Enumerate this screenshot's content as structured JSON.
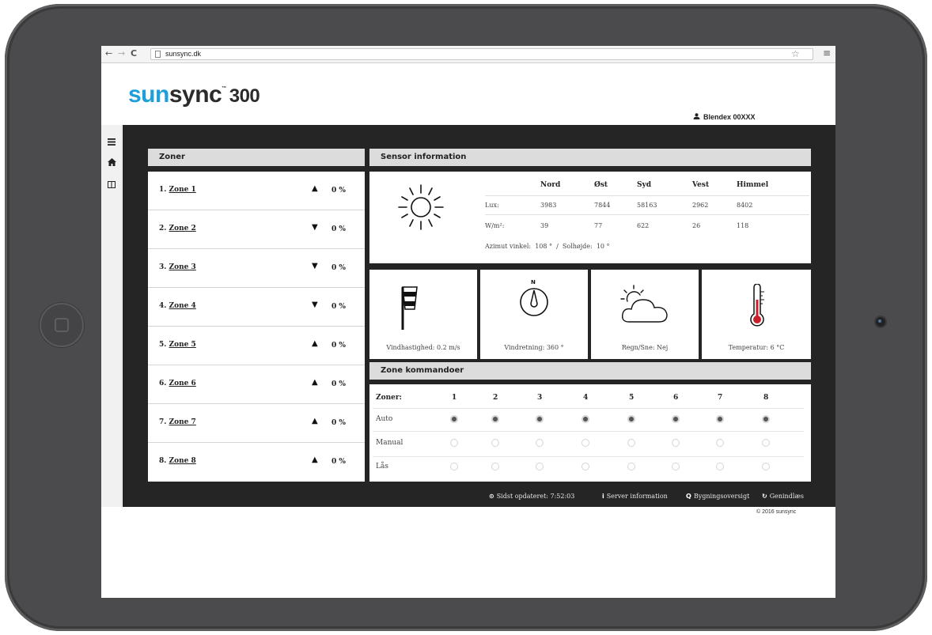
{
  "browser": {
    "back": "←",
    "forward": "→",
    "reload": "C",
    "url": "sunsync.dk",
    "star": "☆",
    "menu": "≡"
  },
  "header": {
    "logo_a": "sun",
    "logo_b": "sync",
    "logo_tm": "™",
    "logo_num": "300",
    "user": "Blendex 00XXX",
    "brand_color": "#1e9fda"
  },
  "nav_icons": [
    "hamburger-icon",
    "home-icon",
    "columns-icon"
  ],
  "zones": {
    "title": "Zoner",
    "items": [
      {
        "num": "1.",
        "name": "Zone 1",
        "direction": "up",
        "arrow": "▲",
        "pct": "0 %"
      },
      {
        "num": "2.",
        "name": "Zone 2",
        "direction": "down",
        "arrow": "▼",
        "pct": "0 %"
      },
      {
        "num": "3.",
        "name": "Zone 3",
        "direction": "down",
        "arrow": "▼",
        "pct": "0 %"
      },
      {
        "num": "4.",
        "name": "Zone 4",
        "direction": "down",
        "arrow": "▼",
        "pct": "0 %"
      },
      {
        "num": "5.",
        "name": "Zone 5",
        "direction": "up",
        "arrow": "▲",
        "pct": "0 %"
      },
      {
        "num": "6.",
        "name": "Zone 6",
        "direction": "up",
        "arrow": "▲",
        "pct": "0 %"
      },
      {
        "num": "7.",
        "name": "Zone 7",
        "direction": "up",
        "arrow": "▲",
        "pct": "0 %"
      },
      {
        "num": "8.",
        "name": "Zone 8",
        "direction": "up",
        "arrow": "▲",
        "pct": "0 %"
      }
    ]
  },
  "sensor": {
    "title": "Sensor information",
    "columns": [
      "Nord",
      "Øst",
      "Syd",
      "Vest",
      "Himmel"
    ],
    "lux_label": "Lux:",
    "lux": [
      "3983",
      "7844",
      "58163",
      "2962",
      "8402"
    ],
    "wm2_label": "W/m²:",
    "wm2": [
      "39",
      "77",
      "622",
      "26",
      "118"
    ],
    "angles": "Azimut vinkel:  108 °  /  Solhøjde:  10 °"
  },
  "tiles": {
    "wind_speed": "Vindhastighed: 0.2 m/s",
    "wind_dir": "Vindretning: 360 °",
    "compass_n": "N",
    "rain": "Regn/Sne: Nej",
    "temp": "Temperatur: 6 °C"
  },
  "commands": {
    "title": "Zone kommandoer",
    "zones_label": "Zoner:",
    "zone_numbers": [
      "1",
      "2",
      "3",
      "4",
      "5",
      "6",
      "7",
      "8"
    ],
    "rows": [
      {
        "label": "Auto",
        "selected": true
      },
      {
        "label": "Manual",
        "selected": false
      },
      {
        "label": "Lås",
        "selected": false
      }
    ]
  },
  "footer": {
    "updated": "Sidst opdateret: 7:52:03",
    "server": "Server information",
    "building": "Bygningsoversigt",
    "reload": "Genindlæs",
    "copyright": "© 2016 sunsync"
  }
}
